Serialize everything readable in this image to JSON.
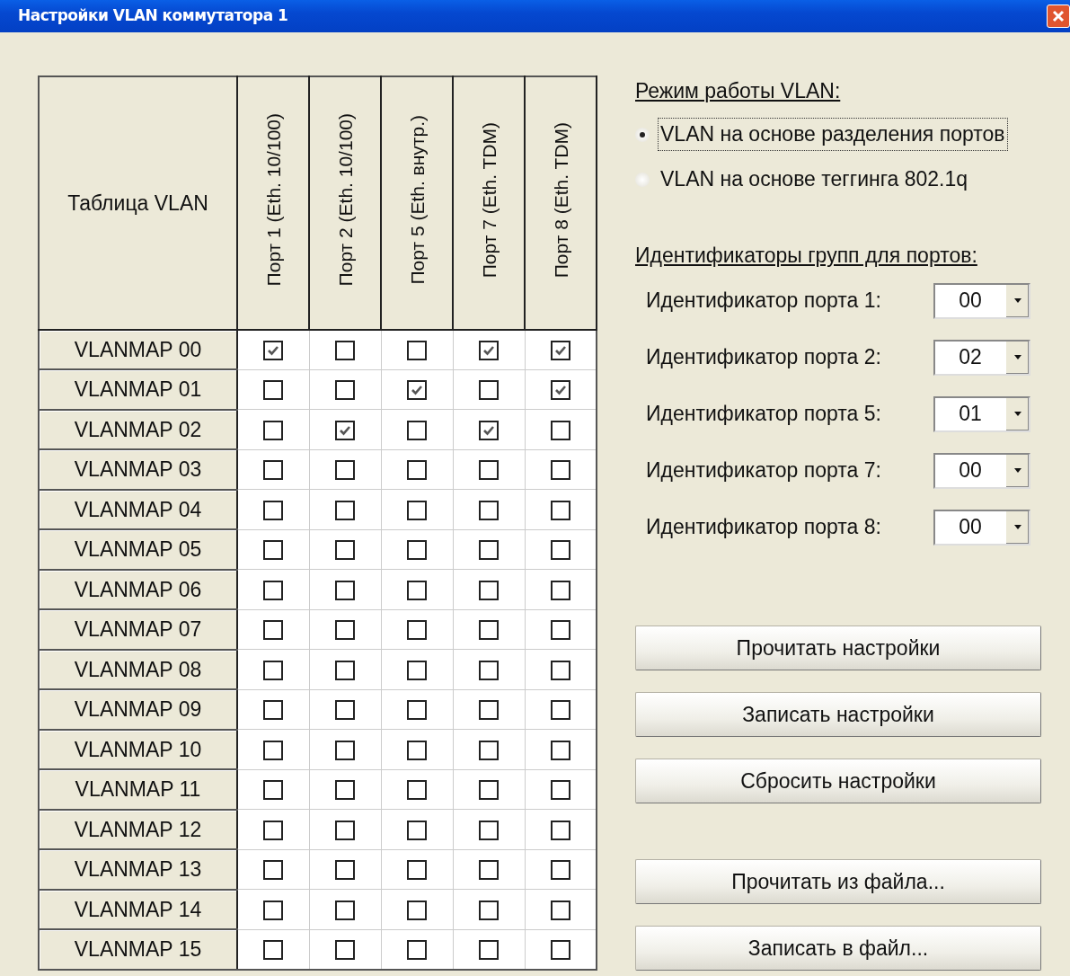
{
  "window": {
    "title": "Настройки VLAN коммутатора 1"
  },
  "table": {
    "corner": "Таблица VLAN",
    "columns": [
      "Порт 1 (Eth. 10/100)",
      "Порт 2 (Eth. 10/100)",
      "Порт 5 (Eth. внутр.)",
      "Порт 7 (Eth. TDM)",
      "Порт 8 (Eth. TDM)"
    ],
    "rows": [
      {
        "label": "VLANMAP 00",
        "checks": [
          true,
          false,
          false,
          true,
          true
        ]
      },
      {
        "label": "VLANMAP 01",
        "checks": [
          false,
          false,
          true,
          false,
          true
        ]
      },
      {
        "label": "VLANMAP 02",
        "checks": [
          false,
          true,
          false,
          true,
          false
        ]
      },
      {
        "label": "VLANMAP 03",
        "checks": [
          false,
          false,
          false,
          false,
          false
        ]
      },
      {
        "label": "VLANMAP 04",
        "checks": [
          false,
          false,
          false,
          false,
          false
        ]
      },
      {
        "label": "VLANMAP 05",
        "checks": [
          false,
          false,
          false,
          false,
          false
        ]
      },
      {
        "label": "VLANMAP 06",
        "checks": [
          false,
          false,
          false,
          false,
          false
        ]
      },
      {
        "label": "VLANMAP 07",
        "checks": [
          false,
          false,
          false,
          false,
          false
        ]
      },
      {
        "label": "VLANMAP 08",
        "checks": [
          false,
          false,
          false,
          false,
          false
        ]
      },
      {
        "label": "VLANMAP 09",
        "checks": [
          false,
          false,
          false,
          false,
          false
        ]
      },
      {
        "label": "VLANMAP 10",
        "checks": [
          false,
          false,
          false,
          false,
          false
        ]
      },
      {
        "label": "VLANMAP 11",
        "checks": [
          false,
          false,
          false,
          false,
          false
        ]
      },
      {
        "label": "VLANMAP 12",
        "checks": [
          false,
          false,
          false,
          false,
          false
        ]
      },
      {
        "label": "VLANMAP 13",
        "checks": [
          false,
          false,
          false,
          false,
          false
        ]
      },
      {
        "label": "VLANMAP 14",
        "checks": [
          false,
          false,
          false,
          false,
          false
        ]
      },
      {
        "label": "VLANMAP 15",
        "checks": [
          false,
          false,
          false,
          false,
          false
        ]
      }
    ]
  },
  "mode": {
    "heading": "Режим работы VLAN:",
    "options": [
      {
        "label": "VLAN на основе разделения портов",
        "selected": true
      },
      {
        "label": "VLAN на основе теггинга 802.1q",
        "selected": false
      }
    ]
  },
  "identifiers": {
    "heading": "Идентификаторы групп для портов:",
    "fields": [
      {
        "label": "Идентификатор порта 1:",
        "value": "00"
      },
      {
        "label": "Идентификатор порта 2:",
        "value": "02"
      },
      {
        "label": "Идентификатор порта 5:",
        "value": "01"
      },
      {
        "label": "Идентификатор порта 7:",
        "value": "00"
      },
      {
        "label": "Идентификатор порта 8:",
        "value": "00"
      }
    ]
  },
  "button_groups": [
    [
      "Прочитать настройки",
      "Записать настройки",
      "Сбросить настройки"
    ],
    [
      "Прочитать из файла...",
      "Записать в файл..."
    ]
  ]
}
